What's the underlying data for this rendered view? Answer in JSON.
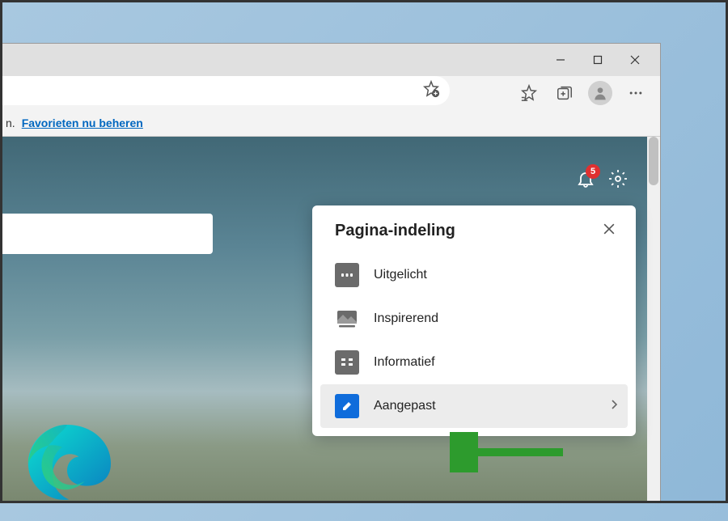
{
  "window": {
    "minimize": "–",
    "maximize": "□",
    "close": "×"
  },
  "favbar": {
    "suffix": "n.",
    "link": "Favorieten nu beheren"
  },
  "notifications": {
    "count": "5"
  },
  "popup": {
    "title": "Pagina-indeling",
    "items": [
      {
        "label": "Uitgelicht"
      },
      {
        "label": "Inspirerend"
      },
      {
        "label": "Informatief"
      },
      {
        "label": "Aangepast"
      }
    ]
  }
}
